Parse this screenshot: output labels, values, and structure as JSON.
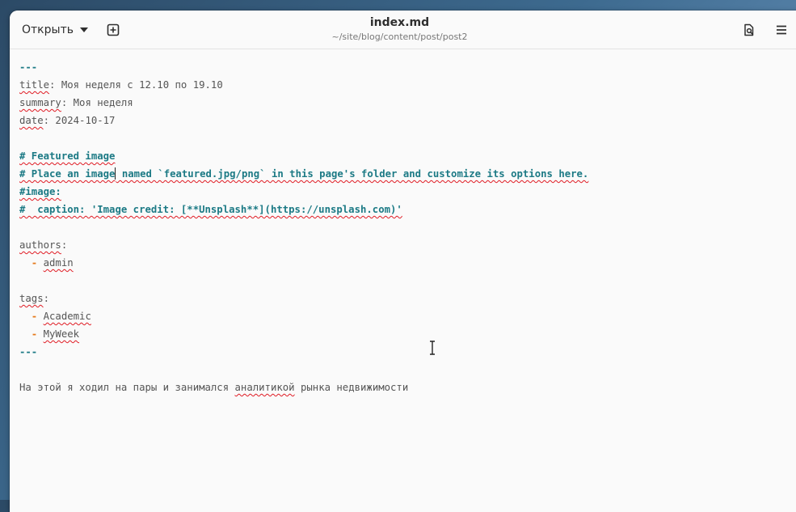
{
  "header": {
    "open_label": "Открыть",
    "title": "index.md",
    "path": "~/site/blog/content/post/post2"
  },
  "icons": {
    "new_tab": "new-tab-icon",
    "search": "search-document-icon",
    "menu": "hamburger-menu-icon"
  },
  "document": {
    "front_matter_start": "---",
    "title_key": "title",
    "title_value": ": Моя неделя с 12.10 по 19.10",
    "summary_key": "summary",
    "summary_value": ": Моя неделя",
    "date_key": "date",
    "date_value": ": 2024-10-17",
    "comment1": "# Featured image",
    "comment2_a": "# Place an image",
    "comment2_b": " named `featured.jpg/png` in this page's folder and customize its options here.",
    "comment3": "#image:",
    "comment4": "#  caption: 'Image credit: [**Unsplash**](https://unsplash.com)'",
    "authors_key": "authors",
    "colon": ":",
    "dash": "  -",
    "author1": "admin",
    "tags_key": "tags",
    "tag1": "Academic",
    "tag2": "MyWeek",
    "front_matter_end": "---",
    "body_a": "На этой я ходил на пары и занимался ",
    "body_b": "аналитикой",
    "body_c": " рынка недвижимости"
  },
  "colors": {
    "comment": "#1c7a85",
    "list_dash": "#e5791c",
    "spell_error": "#e01b24"
  }
}
